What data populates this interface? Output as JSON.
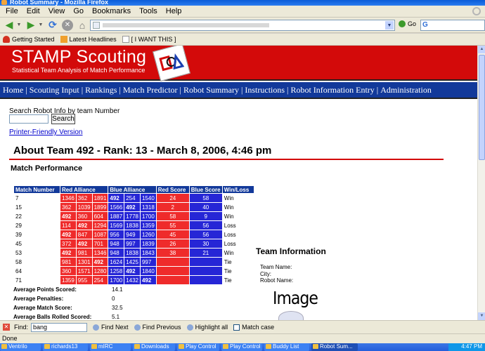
{
  "window": {
    "title": "Robot Summary - Mozilla Firefox"
  },
  "menu": [
    "File",
    "Edit",
    "View",
    "Go",
    "Bookmarks",
    "Tools",
    "Help"
  ],
  "navbar": {
    "go_label": "Go",
    "search_text": "G"
  },
  "bookmarks": [
    "Getting Started",
    "Latest Headlines",
    "[ I WANT THIS ]"
  ],
  "site": {
    "title": "STAMP Scouting",
    "subtitle": "Statistical Team Analysis of Match Performance",
    "nav": [
      "Home",
      "Scouting Input",
      "Rankings",
      "Match Predictor",
      "Robot Summary",
      "Instructions",
      "Robot Information Entry",
      "Administration"
    ],
    "nav_sep": "|"
  },
  "search": {
    "label": "Search Robot Info by team Number",
    "button": "Search",
    "value": ""
  },
  "printer_link": "Printer-Friendly Version",
  "about_title": "About Team 492 - Rank: 13 - March 8, 2006, 4:46 pm",
  "match_performance": {
    "heading": "Match Performance",
    "columns": [
      "Match Number",
      "Red Alliance",
      "Blue Alliance",
      "Red Score",
      "Blue Score",
      "Win/Loss"
    ],
    "rows": [
      {
        "match": "7",
        "red": [
          "1346",
          "362",
          "1891"
        ],
        "blue": [
          "492",
          "254",
          "1540"
        ],
        "red_score": "24",
        "blue_score": "58",
        "result": "Win",
        "bold_red": [],
        "bold_blue": [
          0
        ]
      },
      {
        "match": "15",
        "red": [
          "362",
          "1039",
          "1899"
        ],
        "blue": [
          "1566",
          "492",
          "1318"
        ],
        "red_score": "2",
        "blue_score": "40",
        "result": "Win",
        "bold_red": [],
        "bold_blue": [
          1
        ]
      },
      {
        "match": "22",
        "red": [
          "492",
          "360",
          "604"
        ],
        "blue": [
          "1887",
          "1778",
          "1700"
        ],
        "red_score": "58",
        "blue_score": "9",
        "result": "Win",
        "bold_red": [
          0
        ],
        "bold_blue": []
      },
      {
        "match": "29",
        "red": [
          "114",
          "492",
          "1294"
        ],
        "blue": [
          "1569",
          "1838",
          "1359"
        ],
        "red_score": "55",
        "blue_score": "56",
        "result": "Loss",
        "bold_red": [
          1
        ],
        "bold_blue": []
      },
      {
        "match": "39",
        "red": [
          "492",
          "847",
          "1087"
        ],
        "blue": [
          "956",
          "949",
          "1260"
        ],
        "red_score": "45",
        "blue_score": "56",
        "result": "Loss",
        "bold_red": [
          0
        ],
        "bold_blue": []
      },
      {
        "match": "45",
        "red": [
          "372",
          "492",
          "701"
        ],
        "blue": [
          "948",
          "997",
          "1839"
        ],
        "red_score": "26",
        "blue_score": "30",
        "result": "Loss",
        "bold_red": [
          1
        ],
        "bold_blue": []
      },
      {
        "match": "53",
        "red": [
          "492",
          "981",
          "1346"
        ],
        "blue": [
          "948",
          "1838",
          "1843"
        ],
        "red_score": "38",
        "blue_score": "21",
        "result": "Win",
        "bold_red": [
          0
        ],
        "bold_blue": []
      },
      {
        "match": "58",
        "red": [
          "981",
          "1301",
          "492"
        ],
        "blue": [
          "1624",
          "1425",
          "997"
        ],
        "red_score": "",
        "blue_score": "",
        "result": "Tie",
        "bold_red": [
          2
        ],
        "bold_blue": []
      },
      {
        "match": "64",
        "red": [
          "360",
          "1571",
          "1280"
        ],
        "blue": [
          "1258",
          "492",
          "1840"
        ],
        "red_score": "",
        "blue_score": "",
        "result": "Tie",
        "bold_red": [],
        "bold_blue": [
          1
        ]
      },
      {
        "match": "71",
        "red": [
          "1359",
          "955",
          "254"
        ],
        "blue": [
          "1700",
          "1432",
          "492"
        ],
        "red_score": "",
        "blue_score": "",
        "result": "Tie",
        "bold_red": [],
        "bold_blue": [
          2
        ]
      }
    ]
  },
  "stats": [
    {
      "label": "Average Points Scored:",
      "value": "14.1"
    },
    {
      "label": "Average Penalties:",
      "value": "0"
    },
    {
      "label": "Average Match Score:",
      "value": "32.5"
    },
    {
      "label": "Average Balls Rolled Scored:",
      "value": "5.1"
    }
  ],
  "team_info": {
    "heading": "Team Information",
    "fields": [
      "Team Name:",
      "City:",
      "Robot Name:"
    ],
    "image_placeholder": "Image"
  },
  "findbar": {
    "label": "Find:",
    "value": "bang",
    "next": "Find Next",
    "previous": "Find Previous",
    "highlight": "Highlight all",
    "match_case": "Match case"
  },
  "status": "Done",
  "taskbar": [
    "Ventrilo",
    "richards13",
    "mIRC",
    "Downloads",
    "Play Control",
    "Play Control",
    "Buddy List",
    "Robot Sum..."
  ],
  "clock": "4:47 PM"
}
